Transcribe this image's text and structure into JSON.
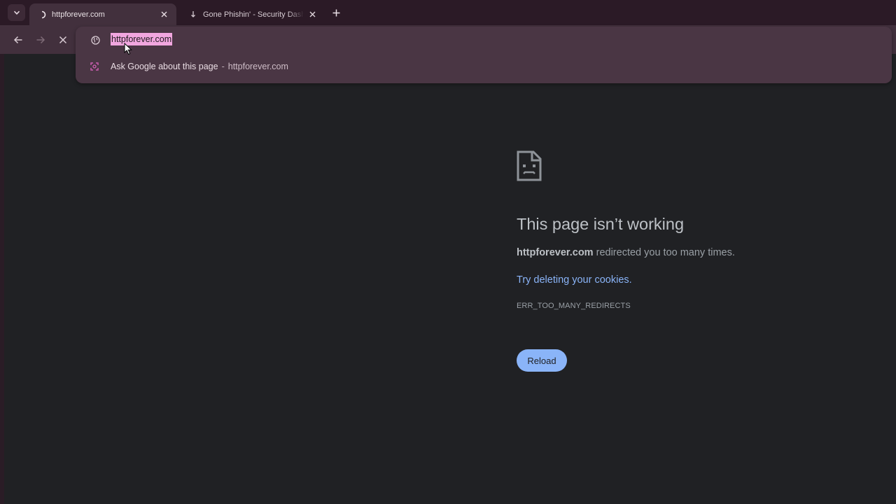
{
  "tabs": {
    "active": {
      "title": "httpforever.com",
      "close_label": "✕"
    },
    "inactive": {
      "title": "Gone Phishin' - Security Dashboard",
      "close_label": "✕"
    },
    "new_tab_label": "+"
  },
  "omnibox": {
    "url": "httpforever.com",
    "suggestion": {
      "label": "Ask Google about this page",
      "separator": "-",
      "domain": "httpforever.com"
    }
  },
  "error_page": {
    "title": "This page isn’t working",
    "desc_host": "httpforever.com",
    "desc_rest": " redirected you too many times.",
    "link": "Try deleting your cookies.",
    "code": "ERR_TOO_MANY_REDIRECTS",
    "reload_label": "Reload"
  },
  "icons": {
    "tab_search": "chevron-down-icon",
    "active_favicon": "loading-spinner-icon",
    "inactive_favicon": "download-arrow-icon",
    "back": "arrow-left-icon",
    "forward": "arrow-right-icon",
    "stop": "close-icon",
    "site_info": "globe-icon",
    "suggestion": "google-lens-icon",
    "error": "sad-document-icon"
  },
  "colors": {
    "frame": "#2b1a26",
    "toolbar": "#42303d",
    "page_bg": "#202124",
    "link": "#8ab4f8",
    "selection": "#f1a6df"
  }
}
